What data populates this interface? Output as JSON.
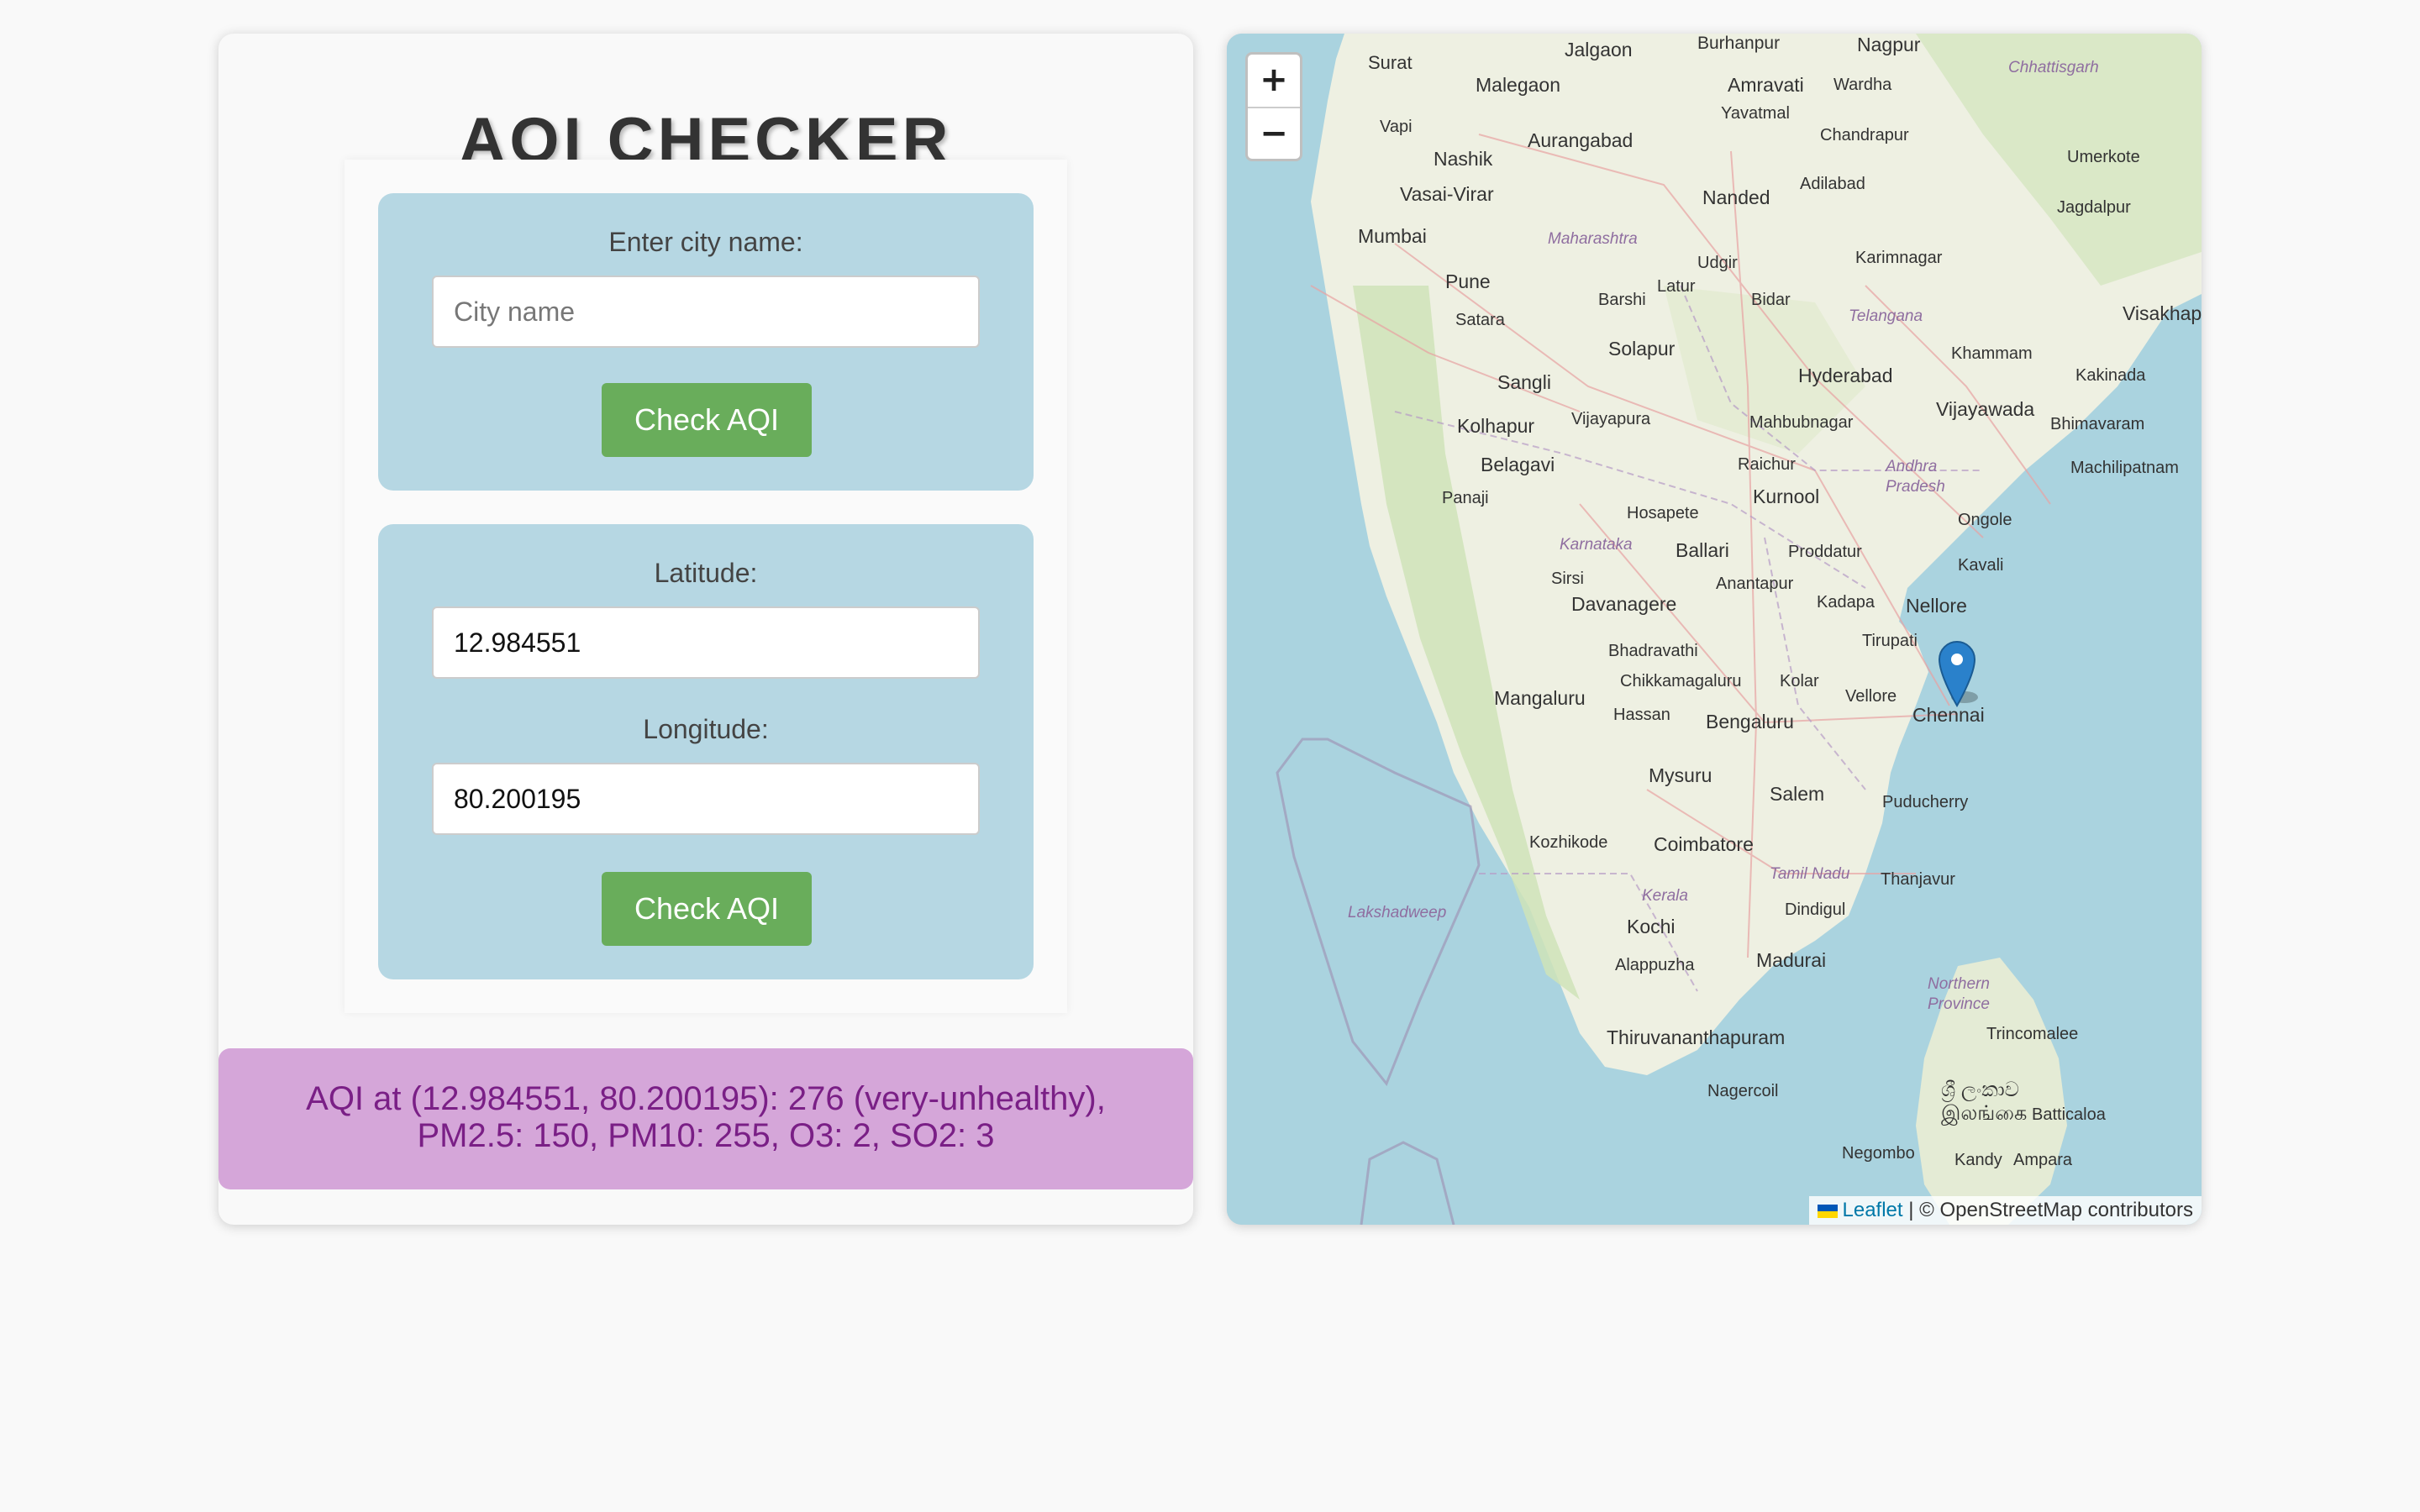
{
  "app": {
    "title": "AQI CHECKER"
  },
  "city_form": {
    "label": "Enter city name:",
    "input_value": "",
    "input_placeholder": "City name",
    "button_label": "Check AQI"
  },
  "coords_form": {
    "lat_label": "Latitude:",
    "lat_value": "12.984551",
    "lon_label": "Longitude:",
    "lon_value": "80.200195",
    "button_label": "Check AQI"
  },
  "result": {
    "line1": "AQI at (12.984551, 80.200195): 276 (very-unhealthy),",
    "line2": "PM2.5: 150, PM10: 255, O3: 2, SO2: 3"
  },
  "map": {
    "zoom_in": "+",
    "zoom_out": "−",
    "attribution_link": "Leaflet",
    "attribution_text": " | © OpenStreetMap contributors",
    "marker_city": "Chennai",
    "cities": [
      "Jalgaon",
      "Burhanpur",
      "Nagpur",
      "Surat",
      "Malegaon",
      "Amravati",
      "Wardha",
      "Yavatmal",
      "Vapi",
      "Aurangabad",
      "Chandrapur",
      "Nashik",
      "Umerkote",
      "Vasai-Virar",
      "Nanded",
      "Adilabad",
      "Jagdalpur",
      "Mumbai",
      "Udgir",
      "Karimnagar",
      "Pune",
      "Latur",
      "Bidar",
      "Barshi",
      "Visakhapatnam",
      "Satara",
      "Solapur",
      "Khammam",
      "Hyderabad",
      "Sangli",
      "Kakinada",
      "Kolhapur",
      "Vijayapura",
      "Mahbubnagar",
      "Vijayawada",
      "Bhimavaram",
      "Belagavi",
      "Machilipatnam",
      "Raichur",
      "Panaji",
      "Kurnool",
      "Ongole",
      "Hosapete",
      "Ballari",
      "Proddatur",
      "Sirsi",
      "Anantapur",
      "Kavali",
      "Davanagere",
      "Kadapa",
      "Nellore",
      "Bhadravathi",
      "Tirupati",
      "Chikkamagaluru",
      "Kolar",
      "Mangaluru",
      "Vellore",
      "Hassan",
      "Bengaluru",
      "Mysuru",
      "Salem",
      "Puducherry",
      "Kozhikode",
      "Coimbatore",
      "Thanjavur",
      "Kochi",
      "Dindigul",
      "Alappuzha",
      "Madurai",
      "Thiruvananthapuram",
      "Trincomalee",
      "Nagercoil",
      "Batticaloa",
      "Negombo",
      "Kandy",
      "Ampara"
    ],
    "states": [
      "Chhattisgarh",
      "Maharashtra",
      "Telangana",
      "Andhra Pradesh",
      "Karnataka",
      "Tamil Nadu",
      "Kerala",
      "Lakshadweep",
      "Northern Province"
    ],
    "sri_lanka_native_1": "ශ්‍රී ලංකාව",
    "sri_lanka_native_2": "இலங்கை"
  }
}
